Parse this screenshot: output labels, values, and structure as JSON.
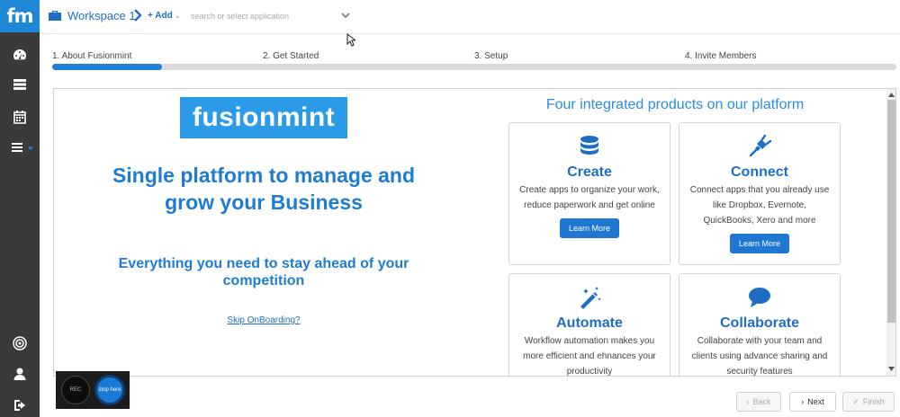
{
  "app": {
    "logo_text": "fm",
    "workspace_title": "Workspace 1",
    "add_label": "+ Add",
    "search_placeholder": "search or select application"
  },
  "sidebar": {
    "icons": [
      "dashboard-icon",
      "list-icon",
      "calendar-icon",
      "menu-icon",
      "target-icon",
      "user-icon",
      "logout-icon"
    ]
  },
  "steps": {
    "items": [
      "1. About Fusionmint",
      "2. Get Started",
      "3. Setup",
      "4. Invite Members"
    ],
    "progress": 0.13
  },
  "intro": {
    "logo_text": "fusionmint",
    "headline": "Single platform to manage and grow your Business",
    "subheadline": "Everything you need to stay ahead of your competition",
    "skip_link": "Skip OnBoarding?"
  },
  "products": {
    "title": "Four integrated products on our platform",
    "cards": [
      {
        "icon": "database-icon",
        "title": "Create",
        "desc": "Create apps to organize your work, reduce paperwork and get online",
        "button": "Learn More"
      },
      {
        "icon": "plug-icon",
        "title": "Connect",
        "desc": "Connect apps that you already use like Dropbox, Evernote, QuickBooks, Xero and more",
        "button": "Learn More"
      },
      {
        "icon": "magic-wand-icon",
        "title": "Automate",
        "desc": "Workflow automation makes you more efficient and ehnances your productivity",
        "button": ""
      },
      {
        "icon": "chat-bubble-icon",
        "title": "Collaborate",
        "desc": "Collaborate with your team and clients using advance sharing and security features",
        "button": ""
      }
    ]
  },
  "recorder": {
    "rec_label": "REC",
    "stop_label": "stop here"
  },
  "footer": {
    "back_label": "Back",
    "next_label": "Next",
    "finish_label": "Finish"
  },
  "colors": {
    "accent": "#1e80d4",
    "sidebar": "#3a3a3a",
    "logo_bg": "#2b9be8"
  }
}
